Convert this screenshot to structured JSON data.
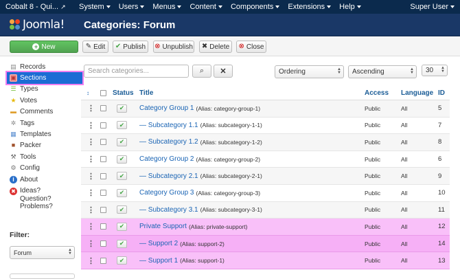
{
  "topbar": {
    "site": "Cobalt 8 - Qui...",
    "menus": [
      "System",
      "Users",
      "Menus",
      "Content",
      "Components",
      "Extensions",
      "Help"
    ],
    "user": "Super User"
  },
  "header": {
    "logo_text": "Joomla!",
    "title": "Categories: Forum"
  },
  "toolbar": {
    "new": "New",
    "edit": "Edit",
    "publish": "Publish",
    "unpublish": "Unpublish",
    "delete": "Delete",
    "close": "Close"
  },
  "sidebar": {
    "items": [
      {
        "label": "Records",
        "icon": "records-icon"
      },
      {
        "label": "Sections",
        "icon": "sections-icon",
        "active": true
      },
      {
        "label": "Types",
        "icon": "types-icon"
      },
      {
        "label": "Votes",
        "icon": "star-icon"
      },
      {
        "label": "Comments",
        "icon": "comments-icon"
      },
      {
        "label": "Tags",
        "icon": "tags-icon"
      },
      {
        "label": "Templates",
        "icon": "templates-icon"
      },
      {
        "label": "Packer",
        "icon": "packer-icon"
      },
      {
        "label": "Tools",
        "icon": "tools-icon"
      },
      {
        "label": "Config",
        "icon": "config-icon"
      },
      {
        "label": "About",
        "icon": "info-icon"
      }
    ],
    "ideas_lines": [
      "Ideas?",
      "Question?",
      "Problems?"
    ],
    "filter_label": "Filter:",
    "filter_value": "Forum"
  },
  "search": {
    "placeholder": "Search categories..."
  },
  "ordering": {
    "sort_field": "Ordering",
    "direction": "Ascending",
    "limit": "30"
  },
  "table": {
    "headers": {
      "status": "Status",
      "title": "Title",
      "access": "Access",
      "language": "Language",
      "id": "ID"
    },
    "rows": [
      {
        "prefix": "",
        "title": "Category Group 1",
        "alias": "(Alias: category-group-1)",
        "access": "Public",
        "language": "All",
        "id": "5",
        "highlight": false
      },
      {
        "prefix": "— ",
        "title": "Subcategory 1.1",
        "alias": "(Alias: subcategory-1-1)",
        "access": "Public",
        "language": "All",
        "id": "7",
        "highlight": false
      },
      {
        "prefix": "— ",
        "title": "Subcategory 1.2",
        "alias": "(Alias: subcategory-1-2)",
        "access": "Public",
        "language": "All",
        "id": "8",
        "highlight": false
      },
      {
        "prefix": "",
        "title": "Category Group 2",
        "alias": "(Alias: category-group-2)",
        "access": "Public",
        "language": "All",
        "id": "6",
        "highlight": false
      },
      {
        "prefix": "— ",
        "title": "Subcategory 2.1",
        "alias": "(Alias: subcategory-2-1)",
        "access": "Public",
        "language": "All",
        "id": "9",
        "highlight": false
      },
      {
        "prefix": "",
        "title": "Category Group 3",
        "alias": "(Alias: category-group-3)",
        "access": "Public",
        "language": "All",
        "id": "10",
        "highlight": false
      },
      {
        "prefix": "— ",
        "title": "Subcategory 3.1",
        "alias": "(Alias: subcategory-3-1)",
        "access": "Public",
        "language": "All",
        "id": "11",
        "highlight": false
      },
      {
        "prefix": "",
        "title": "Private Support",
        "alias": "(Alias: private-support)",
        "access": "Public",
        "language": "All",
        "id": "12",
        "highlight": true
      },
      {
        "prefix": "— ",
        "title": "Support 2",
        "alias": "(Alias: support-2)",
        "access": "Public",
        "language": "All",
        "id": "14",
        "highlight": true
      },
      {
        "prefix": "— ",
        "title": "Support 1",
        "alias": "(Alias: support-1)",
        "access": "Public",
        "language": "All",
        "id": "13",
        "highlight": true
      }
    ]
  }
}
